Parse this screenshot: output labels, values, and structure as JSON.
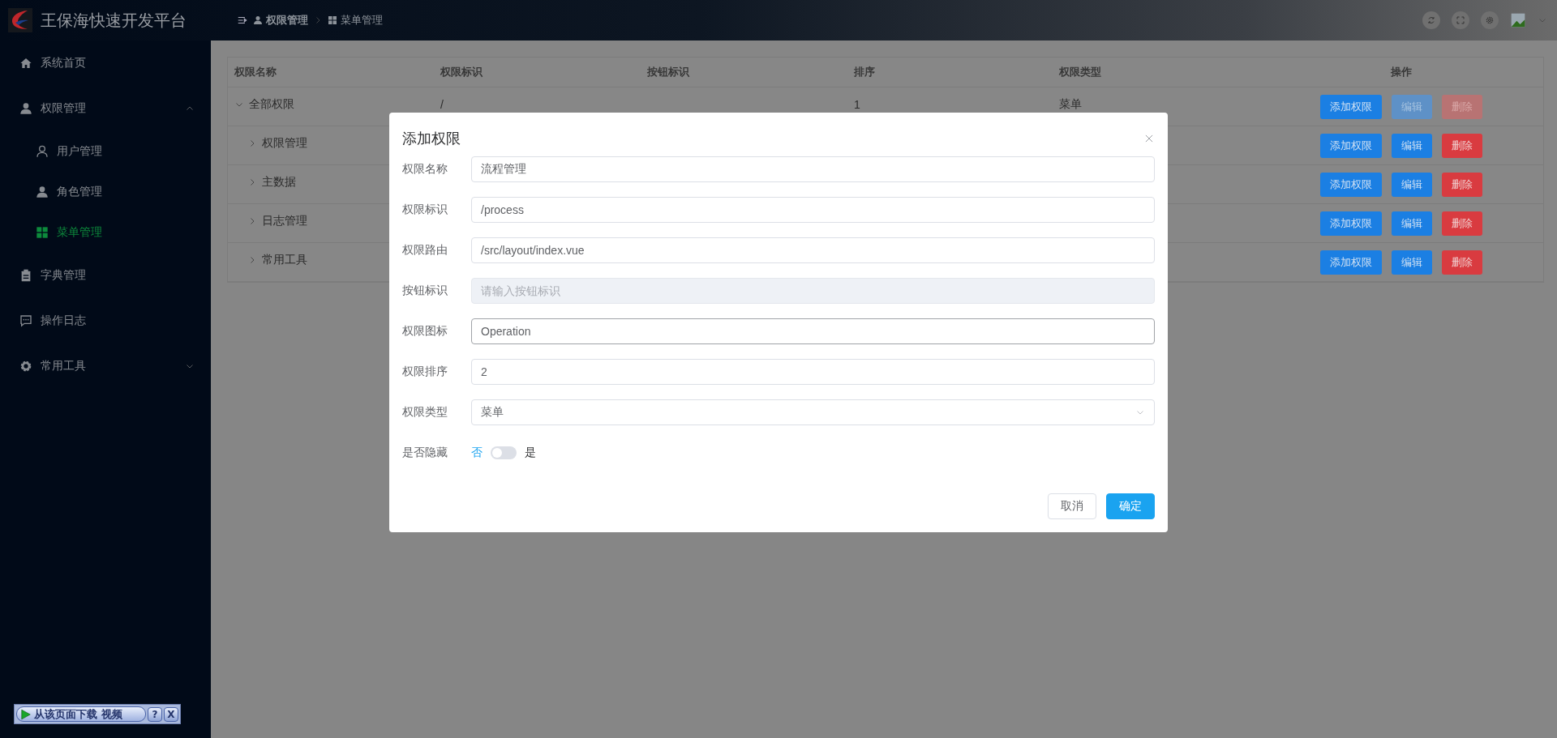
{
  "header": {
    "title": "王保海快速开发平台",
    "breadcrumb": [
      {
        "label": "权限管理"
      },
      {
        "label": "菜单管理"
      }
    ]
  },
  "sidebar": {
    "items": [
      {
        "label": "系统首页",
        "selected": false
      },
      {
        "label": "权限管理",
        "selected": false,
        "expanded": true,
        "children": [
          {
            "label": "用户管理",
            "selected": false
          },
          {
            "label": "角色管理",
            "selected": false
          },
          {
            "label": "菜单管理",
            "selected": true
          }
        ]
      },
      {
        "label": "字典管理",
        "selected": false
      },
      {
        "label": "操作日志",
        "selected": false
      },
      {
        "label": "常用工具",
        "selected": false,
        "expanded": false
      }
    ]
  },
  "table": {
    "columns": [
      "权限名称",
      "权限标识",
      "按钮标识",
      "排序",
      "权限类型",
      "操作"
    ],
    "rows": [
      {
        "name": "全部权限",
        "identifier": "/",
        "order": "1",
        "type": "菜单",
        "expanded": true,
        "actions": [
          {
            "label": "添加权限",
            "kind": "add",
            "disabled": false
          },
          {
            "label": "编辑",
            "kind": "edit",
            "disabled": true
          },
          {
            "label": "删除",
            "kind": "delete",
            "disabled": true
          }
        ],
        "children": [
          {
            "name": "权限管理",
            "expanded": false,
            "actions": [
              {
                "label": "添加权限",
                "kind": "add",
                "disabled": false
              },
              {
                "label": "编辑",
                "kind": "edit",
                "disabled": false
              },
              {
                "label": "删除",
                "kind": "delete",
                "disabled": false
              }
            ]
          },
          {
            "name": "主数据",
            "expanded": false,
            "actions": [
              {
                "label": "添加权限",
                "kind": "add",
                "disabled": false
              },
              {
                "label": "编辑",
                "kind": "edit",
                "disabled": false
              },
              {
                "label": "删除",
                "kind": "delete",
                "disabled": false
              }
            ]
          },
          {
            "name": "日志管理",
            "expanded": false,
            "actions": [
              {
                "label": "添加权限",
                "kind": "add",
                "disabled": false
              },
              {
                "label": "编辑",
                "kind": "edit",
                "disabled": false
              },
              {
                "label": "删除",
                "kind": "delete",
                "disabled": false
              }
            ]
          },
          {
            "name": "常用工具",
            "expanded": false,
            "actions": [
              {
                "label": "添加权限",
                "kind": "add",
                "disabled": false
              },
              {
                "label": "编辑",
                "kind": "edit",
                "disabled": false
              },
              {
                "label": "删除",
                "kind": "delete",
                "disabled": false
              }
            ]
          }
        ]
      }
    ]
  },
  "dialog": {
    "title": "添加权限",
    "fields": [
      {
        "kind": "text",
        "label": "权限名称",
        "value": "流程管理",
        "disabled": false,
        "focused": false
      },
      {
        "kind": "text",
        "label": "权限标识",
        "value": "/process",
        "disabled": false,
        "focused": false
      },
      {
        "kind": "text",
        "label": "权限路由",
        "value": "/src/layout/index.vue",
        "disabled": false,
        "focused": false
      },
      {
        "kind": "text",
        "label": "按钮标识",
        "placeholder": "请输入按钮标识",
        "disabled": true,
        "focused": false
      },
      {
        "kind": "text",
        "label": "权限图标",
        "value": "Operation",
        "disabled": false,
        "focused": true
      },
      {
        "kind": "text",
        "label": "权限排序",
        "value": "2",
        "disabled": false,
        "focused": false
      },
      {
        "kind": "select",
        "label": "权限类型",
        "value": "菜单",
        "disabled": false,
        "focused": false
      },
      {
        "kind": "switch",
        "label": "是否隐藏",
        "off_label": "否",
        "on_label": "是",
        "on": false
      }
    ],
    "buttons": [
      {
        "label": "取消",
        "kind": "default"
      },
      {
        "label": "确定",
        "kind": "primary"
      }
    ]
  },
  "download_bar": {
    "label": "从该页面下载 视频",
    "help": "?",
    "close": "X"
  }
}
